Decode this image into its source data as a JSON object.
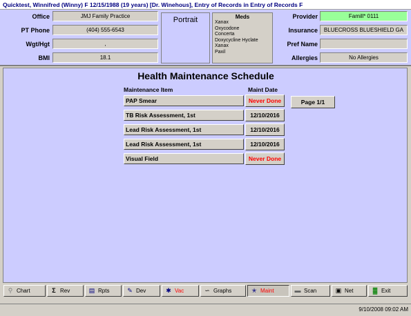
{
  "window": {
    "title": "Quicktest, Winnifred (Winny)  F  12/15/1988 (19 years)  [Dr. Winehous], Entry of Records in Entry of Records F"
  },
  "patient": {
    "office_label": "Office",
    "office_value": "JMJ Family Practice",
    "phone_label": "PT Phone",
    "phone_value": "(404) 555-6543",
    "wgt_label": "Wgt/Hgt",
    "wgt_value": ",",
    "bmi_label": "BMI",
    "bmi_value": "18.1",
    "portrait_label": "Portrait",
    "meds_title": "Meds",
    "meds": [
      "Xanax",
      "Oxycodone",
      "Concerta",
      "Doxycycline Hyclate",
      "Xanax",
      "Paxil"
    ],
    "provider_label": "Provider",
    "provider_value": "Famill* 0111",
    "insurance_label": "Insurance",
    "insurance_value": "BLUECROSS BLUESHIELD GA",
    "pref_name_label": "Pref Name",
    "pref_name_value": "",
    "allergies_label": "Allergies",
    "allergies_value": "No Allergies"
  },
  "schedule": {
    "title": "Health Maintenance Schedule",
    "col_item": "Maintenance Item",
    "col_date": "Maint Date",
    "page_label": "Page 1/1",
    "rows": [
      {
        "item": "PAP Smear",
        "date": "Never Done",
        "never": true
      },
      {
        "item": "TB Risk Assessment, 1st",
        "date": "12/10/2016",
        "never": false
      },
      {
        "item": "Lead Risk Assessment, 1st",
        "date": "12/10/2016",
        "never": false
      },
      {
        "item": "Lead Risk Assessment, 1st",
        "date": "12/10/2016",
        "never": false
      },
      {
        "item": "Visual Field",
        "date": "Never Done",
        "never": true
      }
    ]
  },
  "toolbar": {
    "chart": "Chart",
    "rev": "Rev",
    "rpts": "Rpts",
    "dev": "Dev",
    "vac": "Vac",
    "graphs": "Graphs",
    "maint": "Maint",
    "scan": "Scan",
    "net": "Net",
    "exit": "Exit"
  },
  "status": {
    "datetime": "9/10/2008  09:02 AM"
  }
}
